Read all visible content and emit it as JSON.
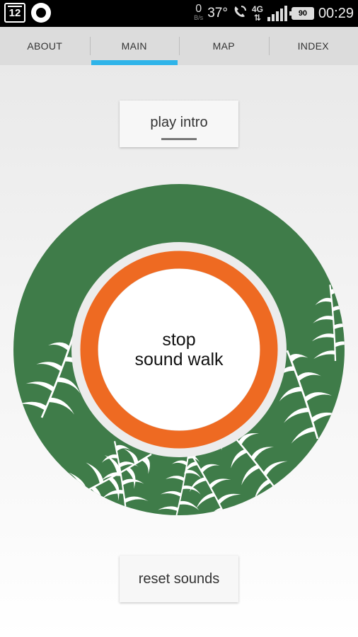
{
  "status_bar": {
    "calendar_day": "12",
    "net_speed_value": "0",
    "net_speed_unit": "B/s",
    "temperature": "37°",
    "network_type": "4G",
    "battery_level": "90",
    "time": "00:29"
  },
  "tabs": [
    {
      "label": "ABOUT",
      "active": false
    },
    {
      "label": "MAIN",
      "active": true
    },
    {
      "label": "MAP",
      "active": false
    },
    {
      "label": "INDEX",
      "active": false
    }
  ],
  "main": {
    "play_intro_label": "play intro",
    "center_line1": "stop",
    "center_line2": "sound walk",
    "reset_label": "reset sounds"
  },
  "colors": {
    "outer_ring": "#3f7c49",
    "progress_ring": "#ee6a22",
    "tab_indicator": "#2fb4e9"
  }
}
